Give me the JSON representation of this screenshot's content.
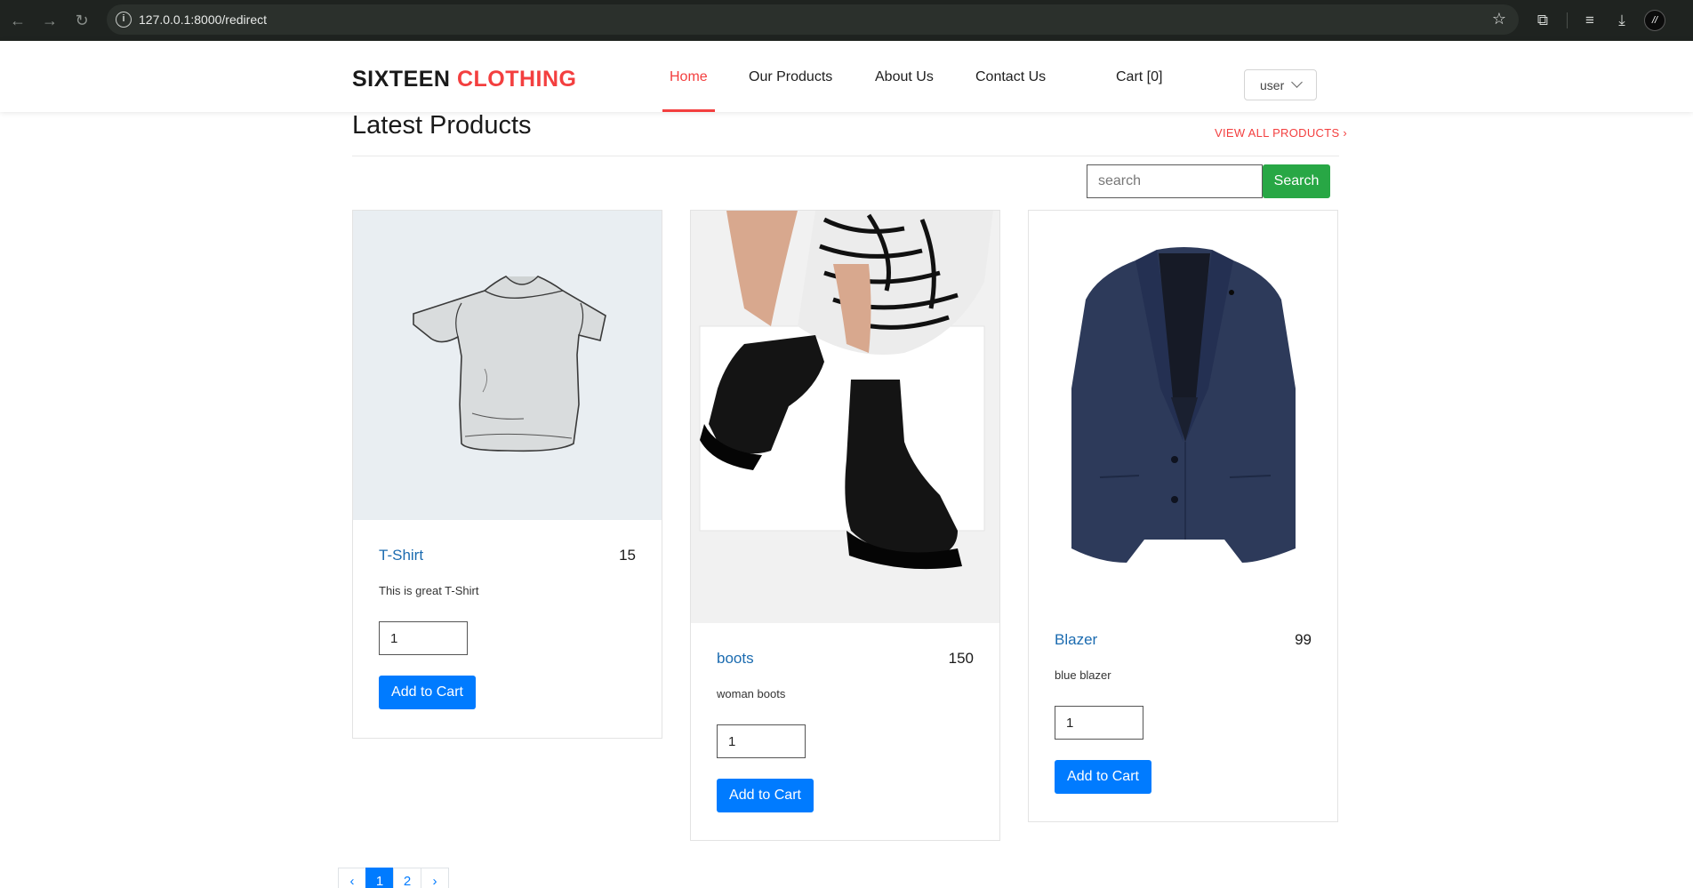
{
  "browser": {
    "url": "127.0.0.1:8000/redirect"
  },
  "header": {
    "brand_part1": "SIXTEEN",
    "brand_part2": "CLOTHING",
    "nav": [
      {
        "label": "Home",
        "active": true
      },
      {
        "label": "Our Products",
        "active": false
      },
      {
        "label": "About Us",
        "active": false
      },
      {
        "label": "Contact Us",
        "active": false
      }
    ],
    "cart_label": "Cart [0]",
    "user_label": "user"
  },
  "section": {
    "title": "Latest Products",
    "view_all": "VIEW ALL PRODUCTS"
  },
  "search": {
    "placeholder": "search",
    "button": "Search"
  },
  "products": [
    {
      "name": "T-Shirt",
      "price": "15",
      "description": "This is great T-Shirt",
      "quantity": "1",
      "button": "Add to Cart"
    },
    {
      "name": "boots",
      "price": "150",
      "description": "woman boots",
      "quantity": "1",
      "button": "Add to Cart"
    },
    {
      "name": "Blazer",
      "price": "99",
      "description": "blue blazer",
      "quantity": "1",
      "button": "Add to Cart"
    }
  ],
  "pagination": {
    "prev": "‹",
    "pages": [
      "1",
      "2"
    ],
    "current": "1",
    "next": "›"
  },
  "colors": {
    "accent_red": "#f33f3f",
    "link_blue": "#1b6bb0",
    "button_blue": "#007bff",
    "search_green": "#28a745"
  }
}
